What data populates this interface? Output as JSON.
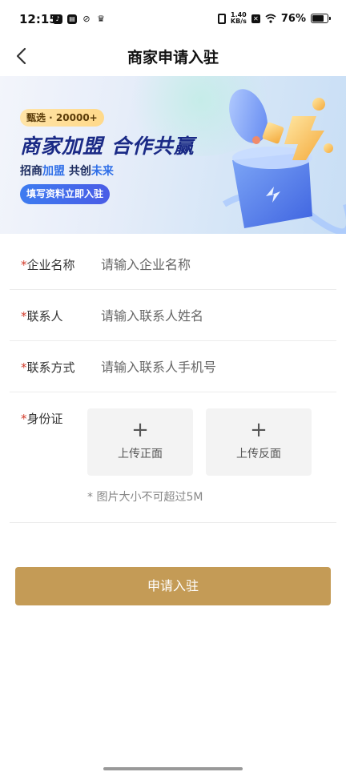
{
  "status_bar": {
    "time": "12:15",
    "net_speed": "1.40\nKB/s",
    "battery_pct": "76%"
  },
  "nav": {
    "title": "商家申请入驻"
  },
  "banner": {
    "badge": "甄选 · 20000+",
    "headline": "商家加盟 合作共赢",
    "sub_prefix": "招商",
    "sub_hl1": "加盟",
    "sub_mid": " 共创",
    "sub_hl2": "未来",
    "cta": "填写资料立即入驻"
  },
  "form": {
    "company_label": "企业名称",
    "company_placeholder": "请输入企业名称",
    "contact_label": "联系人",
    "contact_placeholder": "请输入联系人姓名",
    "phone_label": "联系方式",
    "phone_placeholder": "请输入联系人手机号",
    "id_label": "身份证",
    "id_front": "上传正面",
    "id_back": "上传反面",
    "id_note": "* 图片大小不可超过5M",
    "required_mark": "*"
  },
  "submit": {
    "label": "申请入驻"
  },
  "colors": {
    "accent": "#c49b56",
    "required": "#d23b2b",
    "banner_headline": "#1a2a86"
  }
}
